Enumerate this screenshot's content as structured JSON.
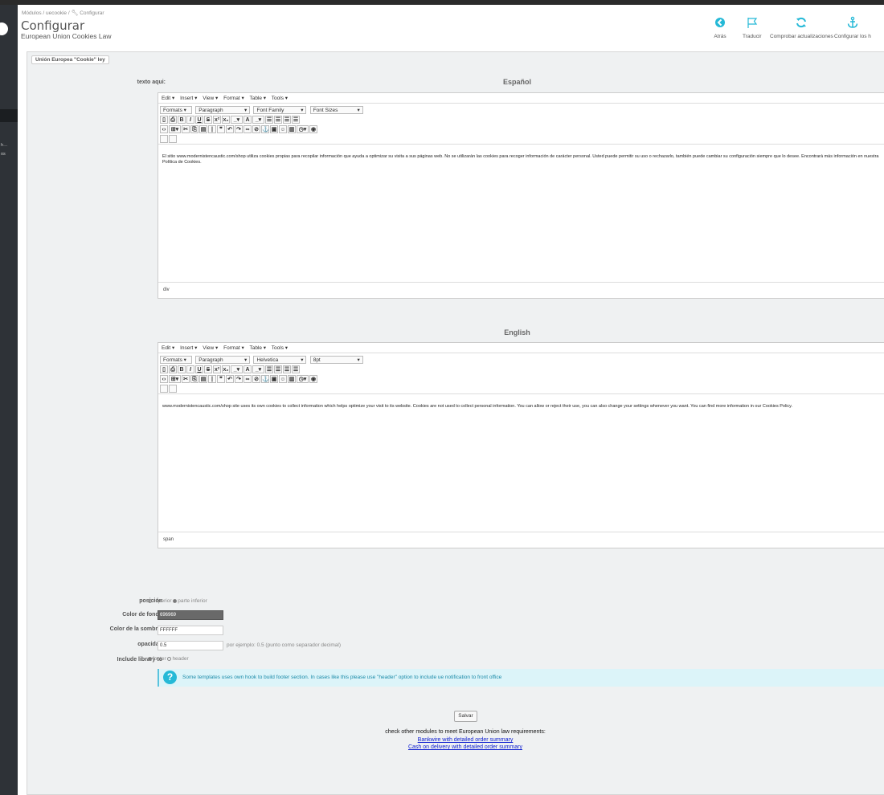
{
  "breadcrumb": {
    "modules": "Módulos",
    "sep1": "/",
    "module": "uecookie",
    "sep2": "/",
    "current": "Configurar"
  },
  "header": {
    "title": "Configurar",
    "subtitle": "European Union Cookies Law"
  },
  "toolbar": [
    {
      "label": "Atrás",
      "icon": "back-circle-icon"
    },
    {
      "label": "Traducir",
      "icon": "flag-icon"
    },
    {
      "label": "Comprobar actualizaciones",
      "icon": "refresh-icon"
    },
    {
      "label": "Configurar los h",
      "icon": "anchor-icon"
    }
  ],
  "sidebar": {
    "items": [
      "h…",
      "os"
    ]
  },
  "panel": {
    "tag": "Unión Europea \"Cookie\" ley"
  },
  "form": {
    "text_label": "texto aqui:",
    "editors": [
      {
        "language": "Español",
        "menubar": [
          "Edit ▾",
          "Insert ▾",
          "View ▾",
          "Format ▾",
          "Table ▾",
          "Tools ▾"
        ],
        "formats": "Formats ▾",
        "block": "Paragraph",
        "font_family": "Font Family",
        "font_size": "Font Sizes",
        "content": "El sitio www.modernistencaustic.com/shop utiliza cookies propias para recopilar información que ayuda a optimizar su visita a sus páginas web. No se utilizarán las cookies para recoger información de carácter personal. Usted puede permitir su uso o rechazarlo, también puede cambiar su configuración siempre que lo desee. Encontrará más información en nuestra Política de Cookies.",
        "status": "div"
      },
      {
        "language": "English",
        "menubar": [
          "Edit ▾",
          "Insert ▾",
          "View ▾",
          "Format ▾",
          "Table ▾",
          "Tools ▾"
        ],
        "formats": "Formats ▾",
        "block": "Paragraph",
        "font_family": "Helvetica",
        "font_size": "8pt",
        "content": "www.modernistencaustic.com/shop site uses its own cookies to collect information which helps optimize your visit to its website. Cookies are not used to collect personal information. You can allow or reject their use, you can also change your settings whenever you want. You can find more information in our Cookies Policy.",
        "status": "span"
      }
    ],
    "position": {
      "label": "posición",
      "opt1": "superior",
      "opt2": "parte inferior"
    },
    "bg_color": {
      "label": "Color de fondo",
      "value": "696969",
      "color": "#696969"
    },
    "shadow_color": {
      "label": "Color de la sombra.",
      "value": "FFFFFF"
    },
    "opacity": {
      "label": "opacidad",
      "value": "0.5",
      "hint": "por ejemplo: 0.5 (punto como separador decimal)"
    },
    "include_lib": {
      "label": "Include library to",
      "opt1": "footer",
      "opt2": "header"
    },
    "info": "Some templates uses own hook to build footer section. In cases like this please use \"header\" option to include ue notification to front office",
    "save": "Salvar",
    "check_text": "check other modules to meet European Union law requirements:",
    "link1": "Bankwire with detailed order summary",
    "link2": "Cash on delivery with detailed order summary"
  }
}
